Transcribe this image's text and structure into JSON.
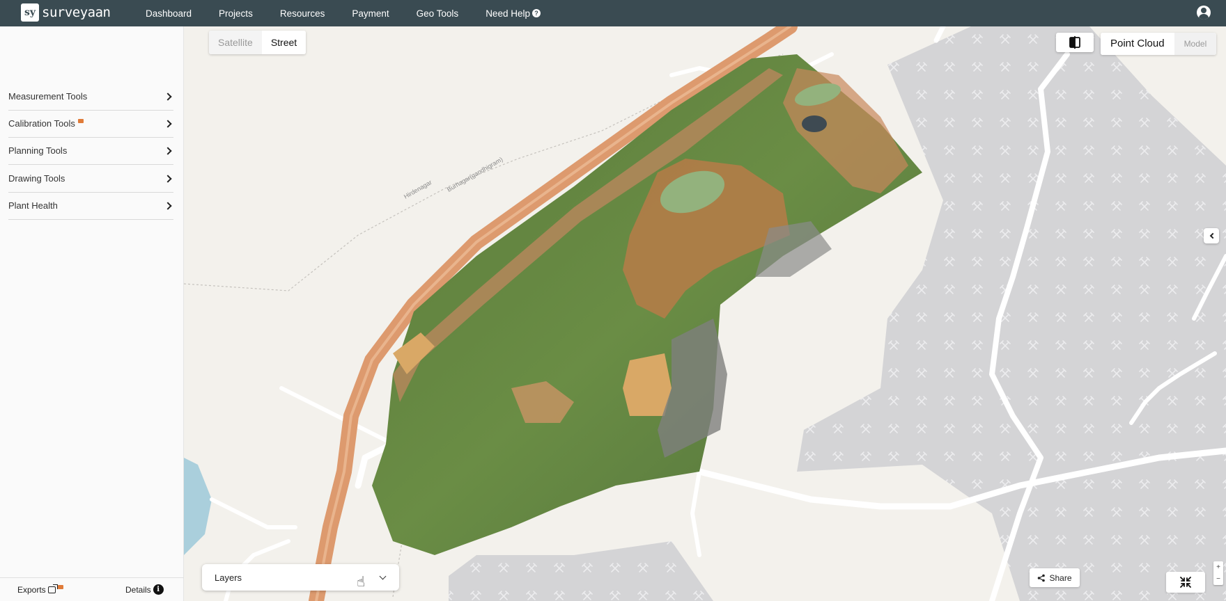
{
  "app": {
    "logo_mark": "sy",
    "logo_text": "surveyaan"
  },
  "nav": {
    "items": [
      "Dashboard",
      "Projects",
      "Resources",
      "Payment",
      "Geo Tools",
      "Need Help"
    ]
  },
  "sidebar": {
    "tools": [
      {
        "label": "Measurement Tools",
        "badge": false
      },
      {
        "label": "Calibration Tools",
        "badge": true
      },
      {
        "label": "Planning Tools",
        "badge": false
      },
      {
        "label": "Drawing Tools",
        "badge": false
      },
      {
        "label": "Plant Health",
        "badge": false
      }
    ],
    "exports_label": "Exports",
    "details_label": "Details"
  },
  "map": {
    "basemap": {
      "satellite": "Satellite",
      "street": "Street",
      "selected": "Street"
    },
    "view": {
      "point_cloud": "Point Cloud",
      "model": "Model",
      "selected": "Point Cloud"
    },
    "place_labels": [
      "Hirdenagar",
      "Burhagar(gandhigram)"
    ],
    "layers_label": "Layers",
    "share_label": "Share",
    "zoom_in": "+",
    "zoom_out": "−"
  },
  "colors": {
    "topbar": "#3a4b52",
    "map_bg": "#f3f1ec",
    "quarry_zone": "#d4d4d6",
    "road": "#ffffff",
    "highway": "#dd9a6e",
    "water": "#aacfdc",
    "badge": "#e07b39"
  }
}
